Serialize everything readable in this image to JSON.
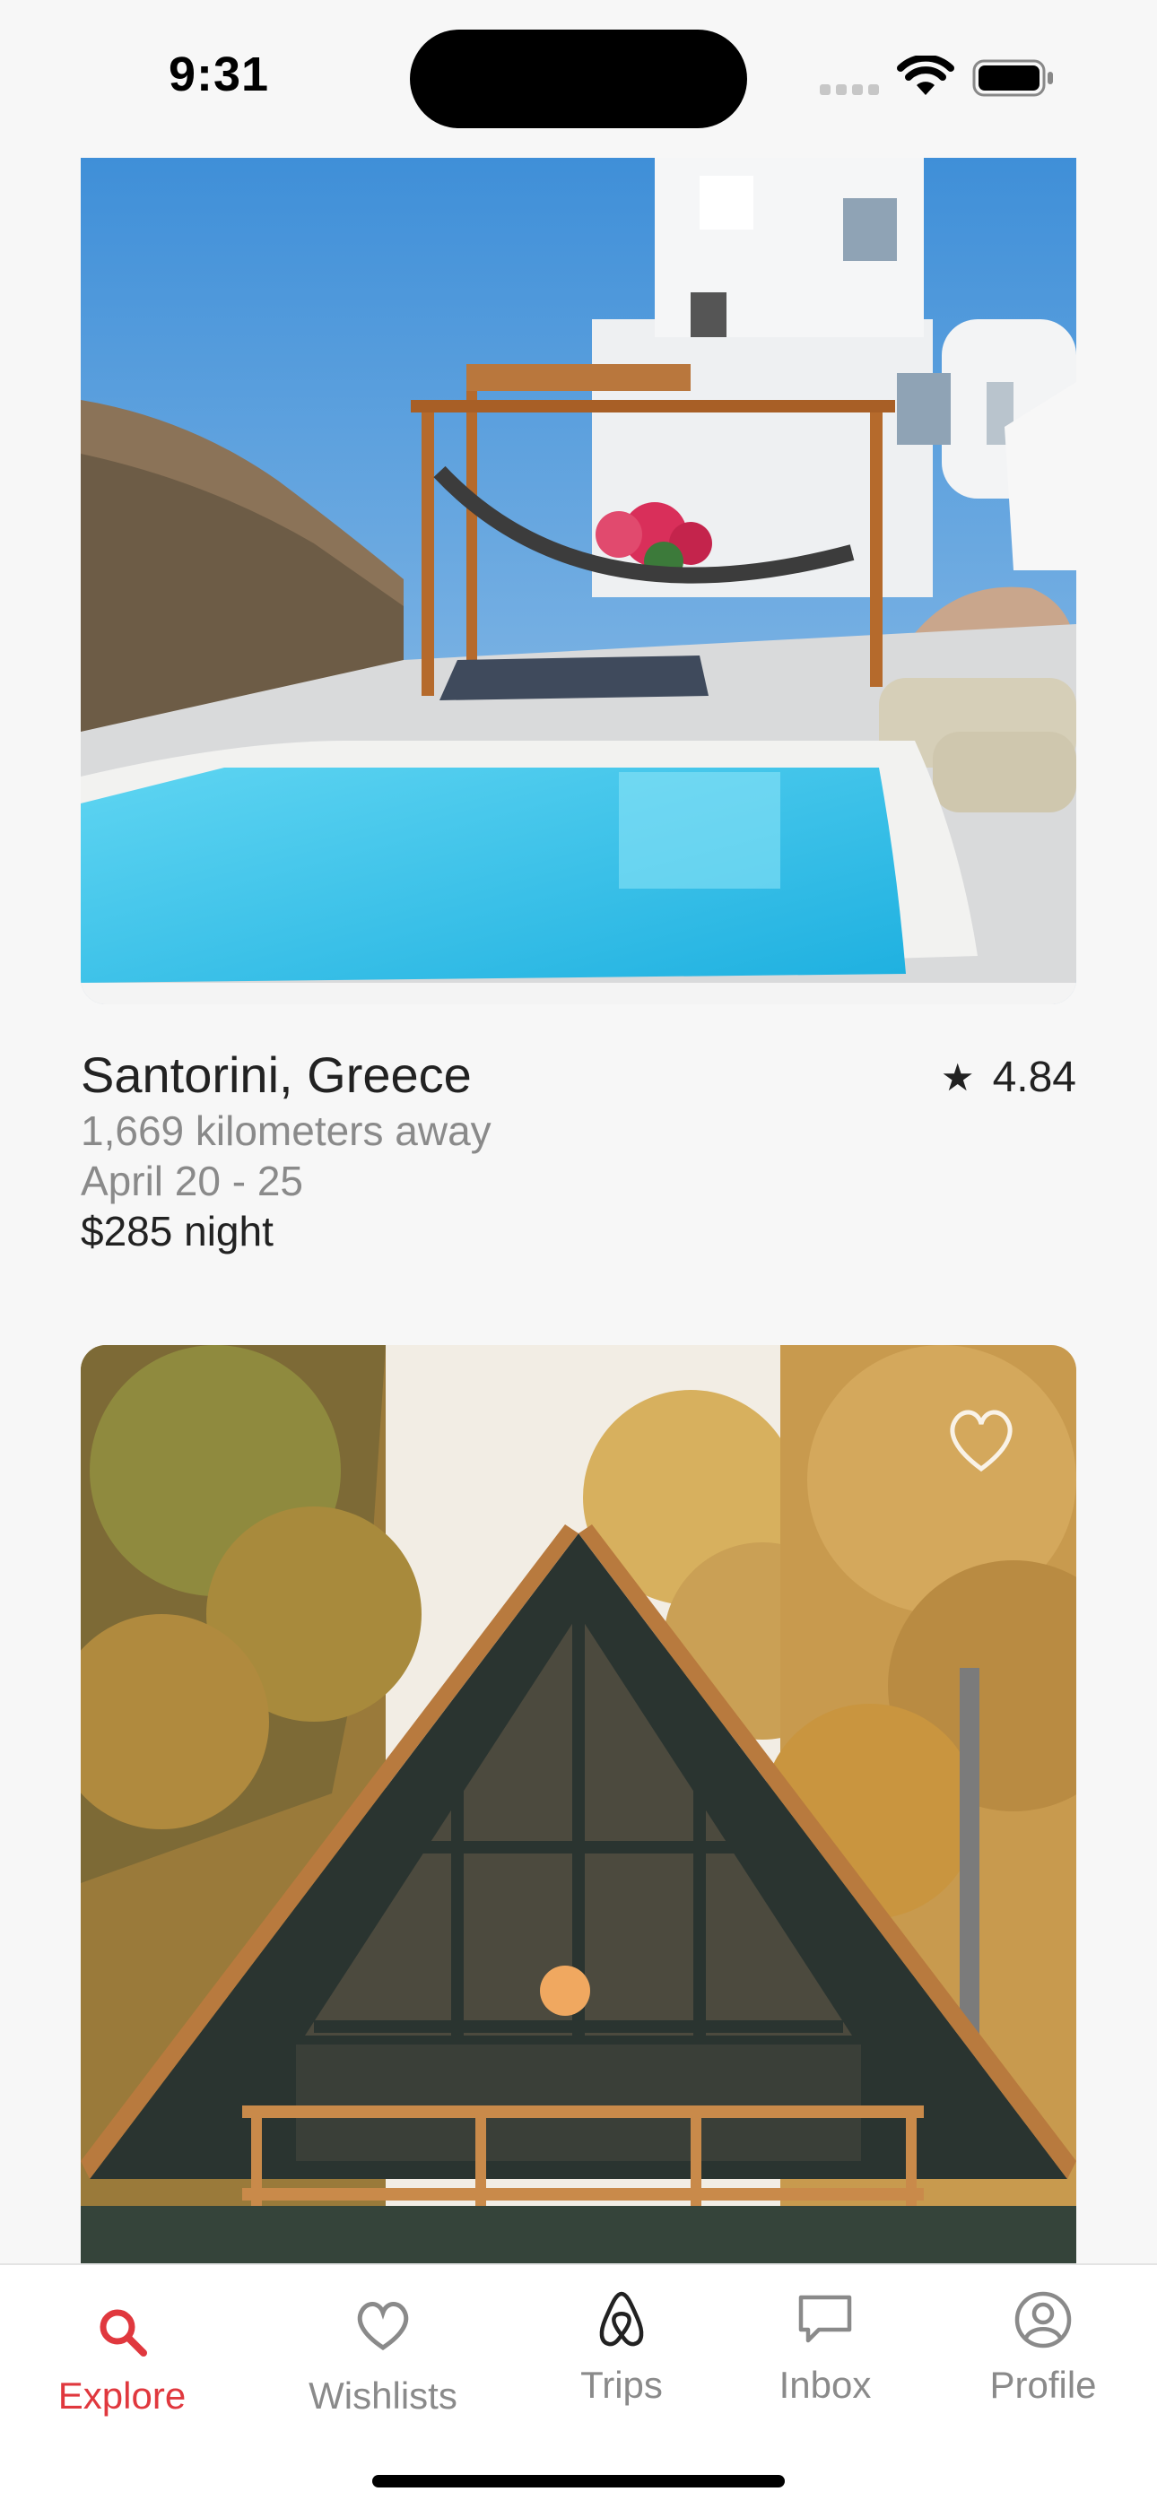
{
  "status_bar": {
    "time": "9:31"
  },
  "listings": [
    {
      "title": "Santorini, Greece",
      "rating": "4.84",
      "distance": "1,669 kilometers away",
      "dates": "April 20 - 25",
      "price": "$285",
      "price_unit": " night",
      "photo_icon": "pool-villa-photo"
    },
    {
      "photo_icon": "a-frame-cabin-photo",
      "wishlist_icon": "heart-outline-icon"
    }
  ],
  "tab_bar": {
    "active_color": "#e0383e",
    "inactive_color": "#8a8a8a",
    "tabs": [
      {
        "label": "Explore",
        "icon": "search-icon",
        "active": true
      },
      {
        "label": "Wishlists",
        "icon": "heart-icon",
        "active": false
      },
      {
        "label": "Trips",
        "icon": "airbnb-logo-icon",
        "active": false
      },
      {
        "label": "Inbox",
        "icon": "message-icon",
        "active": false
      },
      {
        "label": "Profile",
        "icon": "profile-icon",
        "active": false
      }
    ]
  }
}
